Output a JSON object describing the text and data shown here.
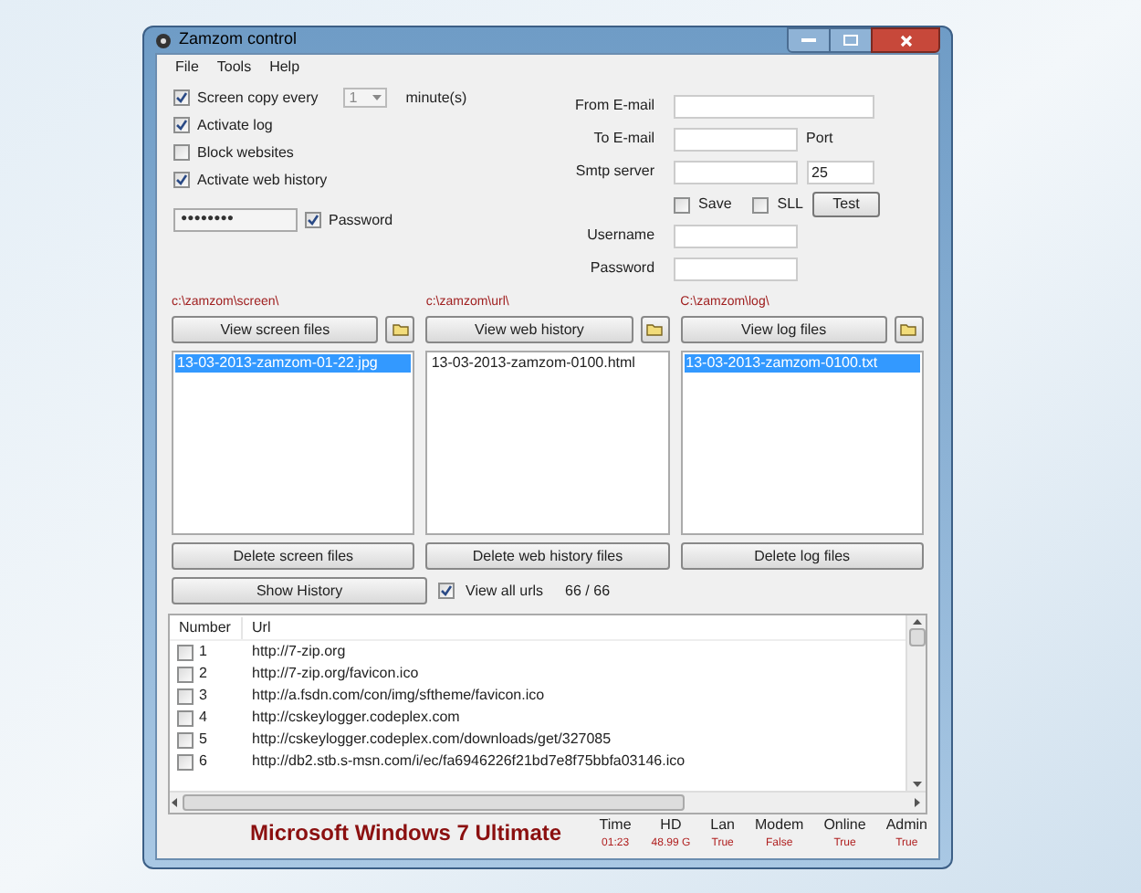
{
  "window": {
    "title": "Zamzom control"
  },
  "menu": [
    "File",
    "Tools",
    "Help"
  ],
  "options": [
    {
      "label": "Screen copy every",
      "checked": true
    },
    {
      "label": "Activate log",
      "checked": true
    },
    {
      "label": "Block websites",
      "checked": false
    },
    {
      "label": "Activate web history",
      "checked": true
    }
  ],
  "interval": {
    "value": "1",
    "unit": "minute(s)"
  },
  "password": {
    "value": "●●●●●●●●",
    "label": "Password",
    "checked": true
  },
  "email": {
    "from_label": "From E-mail",
    "to_label": "To E-mail",
    "port_label": "Port",
    "smtp_label": "Smtp server",
    "port": "25",
    "save": {
      "label": "Save",
      "checked": false
    },
    "ssl": {
      "label": "SLL",
      "checked": false
    },
    "test": "Test",
    "username_label": "Username",
    "password_label": "Password"
  },
  "panels": [
    {
      "path": "c:\\zamzom\\screen\\",
      "view": "View screen files",
      "files": [
        {
          "name": "13-03-2013-zamzom-01-22.jpg",
          "selected": true
        }
      ],
      "delete": "Delete screen files"
    },
    {
      "path": "c:\\zamzom\\url\\",
      "view": "View web history",
      "files": [
        {
          "name": "13-03-2013-zamzom-0100.html",
          "selected": false
        }
      ],
      "delete": "Delete web history files"
    },
    {
      "path": "C:\\zamzom\\log\\",
      "view": "View log files",
      "files": [
        {
          "name": "13-03-2013-zamzom-0100.txt",
          "selected": true
        }
      ],
      "delete": "Delete log files"
    }
  ],
  "show_history": "Show History",
  "view_all": {
    "label": "View all urls",
    "checked": true,
    "count": "66 / 66"
  },
  "table": {
    "columns": [
      "Number",
      "Url"
    ],
    "rows": [
      {
        "number": "1",
        "url": "http://7-zip.org",
        "checked": false
      },
      {
        "number": "2",
        "url": "http://7-zip.org/favicon.ico",
        "checked": false
      },
      {
        "number": "3",
        "url": "http://a.fsdn.com/con/img/sftheme/favicon.ico",
        "checked": false
      },
      {
        "number": "4",
        "url": "http://cskeylogger.codeplex.com",
        "checked": false
      },
      {
        "number": "5",
        "url": "http://cskeylogger.codeplex.com/downloads/get/327085",
        "checked": false
      },
      {
        "number": "6",
        "url": "http://db2.stb.s-msn.com/i/ec/fa6946226f21bd7e8f75bbfa03146.ico",
        "checked": false
      }
    ]
  },
  "os_name": "Microsoft Windows 7 Ultimate",
  "status": [
    {
      "label": "Time",
      "value": "01:23"
    },
    {
      "label": "HD",
      "value": "48.99 G"
    },
    {
      "label": "Lan",
      "value": "True"
    },
    {
      "label": "Modem",
      "value": "False"
    },
    {
      "label": "Online",
      "value": "True"
    },
    {
      "label": "Admin",
      "value": "True"
    }
  ]
}
